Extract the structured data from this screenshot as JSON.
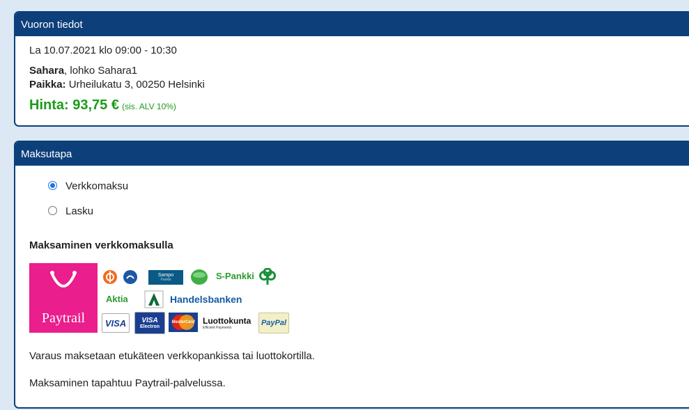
{
  "booking": {
    "header": "Vuoron tiedot",
    "datetime": "La 10.07.2021 klo 09:00 - 10:30",
    "venue_name": "Sahara",
    "venue_rest": ", lohko Sahara1",
    "place_label": "Paikka:",
    "place_value": " Urheilukatu 3, 00250 Helsinki",
    "price": "Hinta: 93,75 €",
    "price_note": "(sis. ALV 10%)"
  },
  "payment": {
    "header": "Maksutapa",
    "options": [
      {
        "label": "Verkkomaksu",
        "selected": true
      },
      {
        "label": "Lasku",
        "selected": false
      }
    ],
    "section_title": "Maksaminen verkkomaksulla",
    "logos": {
      "paytrail": "Paytrail",
      "sampo": "Sampo",
      "sampo_sub": "Pankki",
      "spankki": "S-Pankki",
      "aktia": "Aktia",
      "handelsbanken": "Handelsbanken",
      "visa": "VISA",
      "visa_electron": "VISA",
      "electron": "Electron",
      "mastercard": "MasterCard",
      "luottokunta": "Luottokunta",
      "luottokunta_sub": "Efficient Payments",
      "paypal": "PayPal"
    },
    "info1": "Varaus maksetaan etukäteen verkkopankissa tai luottokortilla.",
    "info2": "Maksaminen tapahtuu Paytrail-palvelussa."
  },
  "colors": {
    "header_bg": "#0d3f7a",
    "price": "#1b9a1b",
    "radio_accent": "#1a73e8",
    "paytrail": "#ea1e8c"
  }
}
